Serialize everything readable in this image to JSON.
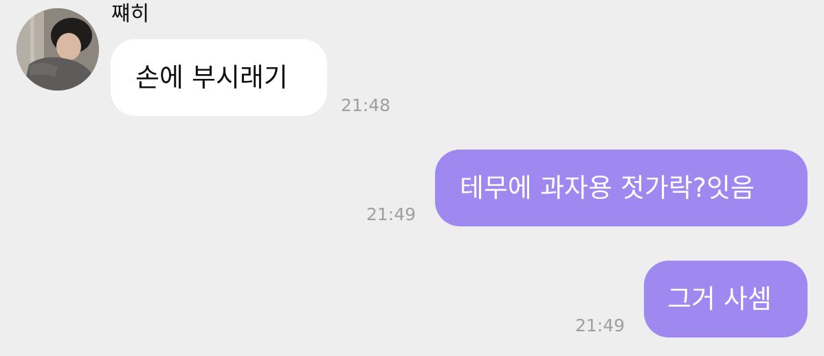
{
  "chat": {
    "incoming": {
      "sender_name": "쨰히",
      "message": "손에 부시래기",
      "time": "21:48"
    },
    "outgoing": [
      {
        "message": "테무에 과자용 젓가락?잇음",
        "time": "21:49"
      },
      {
        "message": "그거 사셈",
        "time": "21:49"
      }
    ]
  },
  "colors": {
    "background": "#eeeeee",
    "incoming_bubble": "#ffffff",
    "outgoing_bubble": "#a088f1",
    "timestamp": "#9e9e9e"
  }
}
